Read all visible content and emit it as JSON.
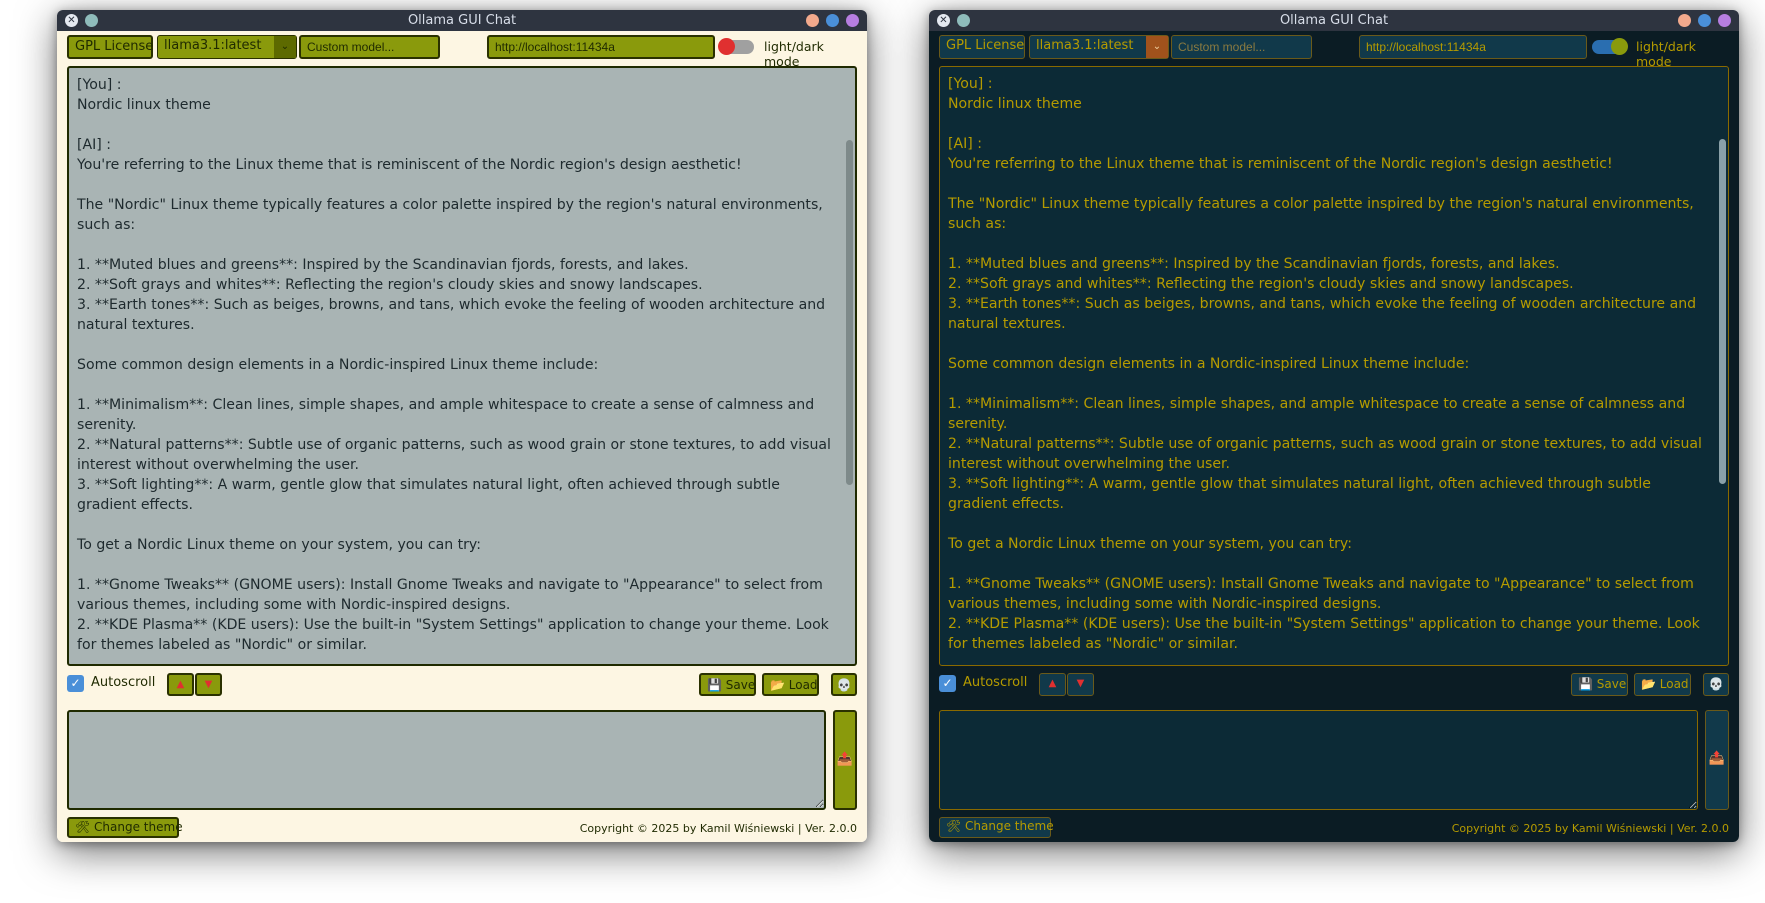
{
  "windows": [
    {
      "theme": "light",
      "title": "Ollama GUI Chat",
      "toolbar": {
        "license_label": "GPL License",
        "model_selected": "llama3.1:latest",
        "custom_model_placeholder": "Custom model...",
        "host_value": "http://localhost:11434a",
        "mode_label": "light/dark mode"
      },
      "chat_text": "[You] :\nNordic linux theme\n\n[AI] :\nYou're referring to the Linux theme that is reminiscent of the Nordic region's design aesthetic!\n\nThe \"Nordic\" Linux theme typically features a color palette inspired by the region's natural environments, such as:\n\n1. **Muted blues and greens**: Inspired by the Scandinavian fjords, forests, and lakes.\n2. **Soft grays and whites**: Reflecting the region's cloudy skies and snowy landscapes.\n3. **Earth tones**: Such as beiges, browns, and tans, which evoke the feeling of wooden architecture and natural textures.\n\nSome common design elements in a Nordic-inspired Linux theme include:\n\n1. **Minimalism**: Clean lines, simple shapes, and ample whitespace to create a sense of calmness and serenity.\n2. **Natural patterns**: Subtle use of organic patterns, such as wood grain or stone textures, to add visual interest without overwhelming the user.\n3. **Soft lighting**: A warm, gentle glow that simulates natural light, often achieved through subtle gradient effects.\n\nTo get a Nordic Linux theme on your system, you can try:\n\n1. **Gnome Tweaks** (GNOME users): Install Gnome Tweaks and navigate to \"Appearance\" to select from various themes, including some with Nordic-inspired designs.\n2. **KDE Plasma** (KDE users): Use the built-in \"System Settings\" application to change your theme. Look for themes labeled as \"Nordic\" or similar.",
      "controls": {
        "autoscroll_label": "Autoscroll",
        "up_icon": "▲",
        "down_icon": "▼",
        "save_label": "💾 Save",
        "load_label": "📂 Load",
        "skull_icon": "💀",
        "send_icon": "📤"
      },
      "footer": {
        "change_theme_label": "🛠 Change theme",
        "copyright": "Copyright © 2025 by Kamil Wiśniewski | Ver. 2.0.0"
      }
    },
    {
      "theme": "dark",
      "title": "Ollama GUI Chat",
      "toolbar": {
        "license_label": "GPL License",
        "model_selected": "llama3.1:latest",
        "custom_model_placeholder": "Custom model...",
        "host_value": "http://localhost:11434a",
        "mode_label": "light/dark mode"
      },
      "chat_text": "[You] :\nNordic linux theme\n\n[AI] :\nYou're referring to the Linux theme that is reminiscent of the Nordic region's design aesthetic!\n\nThe \"Nordic\" Linux theme typically features a color palette inspired by the region's natural environments, such as:\n\n1. **Muted blues and greens**: Inspired by the Scandinavian fjords, forests, and lakes.\n2. **Soft grays and whites**: Reflecting the region's cloudy skies and snowy landscapes.\n3. **Earth tones**: Such as beiges, browns, and tans, which evoke the feeling of wooden architecture and natural textures.\n\nSome common design elements in a Nordic-inspired Linux theme include:\n\n1. **Minimalism**: Clean lines, simple shapes, and ample whitespace to create a sense of calmness and serenity.\n2. **Natural patterns**: Subtle use of organic patterns, such as wood grain or stone textures, to add visual interest without overwhelming the user.\n3. **Soft lighting**: A warm, gentle glow that simulates natural light, often achieved through subtle gradient effects.\n\nTo get a Nordic Linux theme on your system, you can try:\n\n1. **Gnome Tweaks** (GNOME users): Install Gnome Tweaks and navigate to \"Appearance\" to select from various themes, including some with Nordic-inspired designs.\n2. **KDE Plasma** (KDE users): Use the built-in \"System Settings\" application to change your theme. Look for themes labeled as \"Nordic\" or similar.",
      "controls": {
        "autoscroll_label": "Autoscroll",
        "up_icon": "▲",
        "down_icon": "▼",
        "save_label": "💾 Save",
        "load_label": "📂 Load",
        "skull_icon": "💀",
        "send_icon": "📤"
      },
      "footer": {
        "change_theme_label": "🛠 Change theme",
        "copyright": "Copyright © 2025 by Kamil Wiśniewski | Ver. 2.0.0"
      }
    }
  ],
  "colors": {
    "light_accent": "#8a9a0c",
    "light_chat_bg": "#a9b4b4",
    "dark_accent": "#b59b00",
    "dark_chat_bg": "#0c2a36",
    "titlebar_bg": "#2e3440"
  },
  "icons": {
    "close": "close-icon",
    "checkbox": "checkbox-checked-icon",
    "scroll_up": "arrow-up-icon",
    "scroll_down": "arrow-down-icon",
    "save": "floppy-icon",
    "load": "folder-icon",
    "clear": "skull-icon",
    "send": "send-icon",
    "theme": "hammer-icon"
  }
}
